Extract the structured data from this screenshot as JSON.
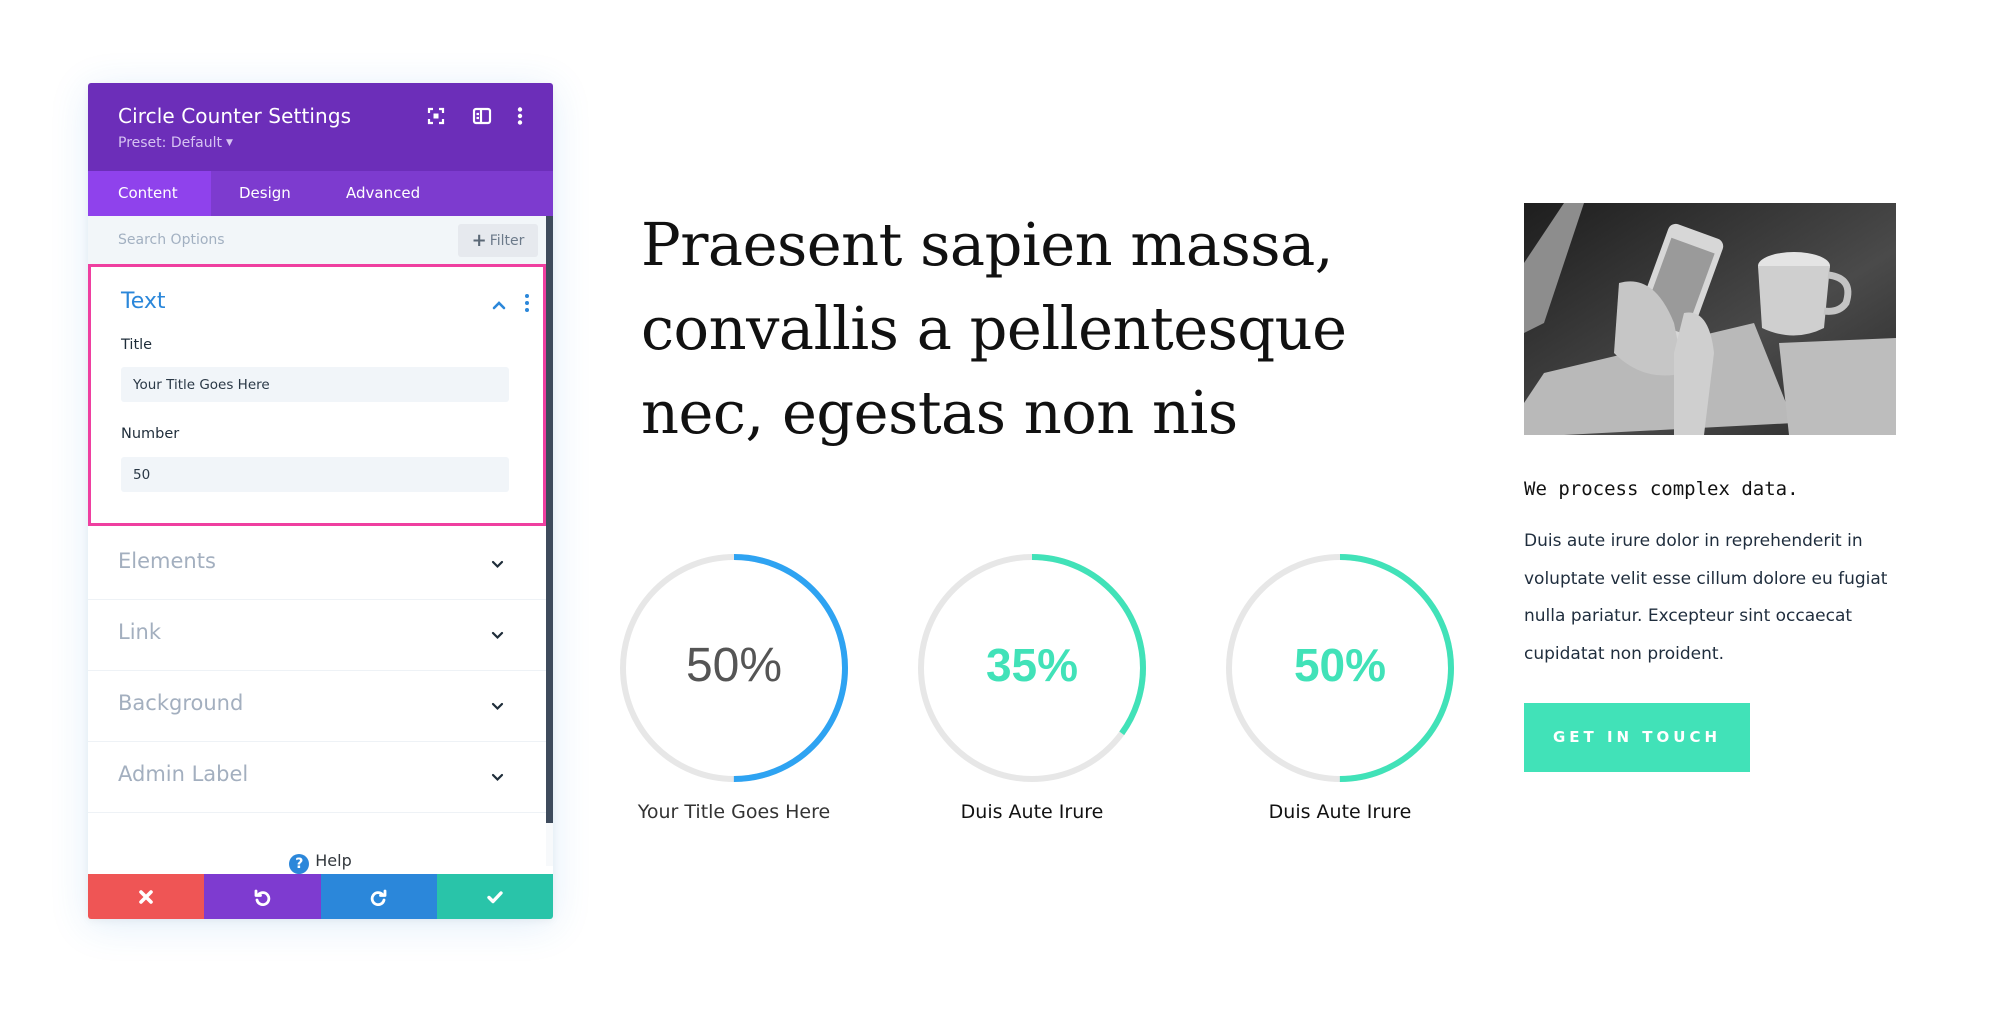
{
  "panel": {
    "title": "Circle Counter Settings",
    "preset": "Preset: Default",
    "header_icons": [
      "focus-mode-icon",
      "split-view-icon",
      "more-options-icon"
    ],
    "tabs": [
      {
        "label": "Content",
        "active": true
      },
      {
        "label": "Design",
        "active": false
      },
      {
        "label": "Advanced",
        "active": false
      }
    ],
    "search": {
      "placeholder": "Search Options",
      "value": ""
    },
    "filter_label": "Filter",
    "open_section": {
      "title": "Text",
      "fields": [
        {
          "label": "Title",
          "value": "Your Title Goes Here"
        },
        {
          "label": "Number",
          "value": "50"
        }
      ]
    },
    "sections": [
      "Elements",
      "Link",
      "Background",
      "Admin Label"
    ],
    "help_label": "Help",
    "footer_buttons": [
      {
        "name": "discard",
        "icon": "close-icon",
        "color": "#ef5555"
      },
      {
        "name": "undo",
        "icon": "undo-icon",
        "color": "#7e3bd0"
      },
      {
        "name": "redo",
        "icon": "redo-icon",
        "color": "#2b87da"
      },
      {
        "name": "save",
        "icon": "check-icon",
        "color": "#29c4a9"
      }
    ],
    "colors": {
      "header": "#6c2eb9",
      "tabs": "#7d3bcf",
      "active_tab": "#8f42ec",
      "highlight_border": "#ef3fa0",
      "accent_blue": "#2b87da"
    }
  },
  "page": {
    "headline": "Praesent sapien massa, convallis a pellentesque nec, egestas non nis",
    "counters": [
      {
        "percent": 50,
        "label": "50%",
        "title": "Your Title Goes Here",
        "color": "#2ea3f2",
        "style": "light"
      },
      {
        "percent": 35,
        "label": "35%",
        "title": "Duis Aute Irure",
        "color": "#41e2b8",
        "style": "bold"
      },
      {
        "percent": 50,
        "label": "50%",
        "title": "Duis Aute Irure",
        "color": "#41e2b8",
        "style": "bold"
      }
    ],
    "image_alt": "Hands holding a smartphone next to a coffee mug and laptop",
    "subhead": "We process complex data.",
    "paragraph": "Duis aute irure dolor in reprehenderit in voluptate velit esse cillum dolore eu fugiat nulla pariatur. Excepteur sint occaecat cupidatat non proident.",
    "cta_label": "GET IN TOUCH",
    "cta_color": "#41e2b8"
  }
}
